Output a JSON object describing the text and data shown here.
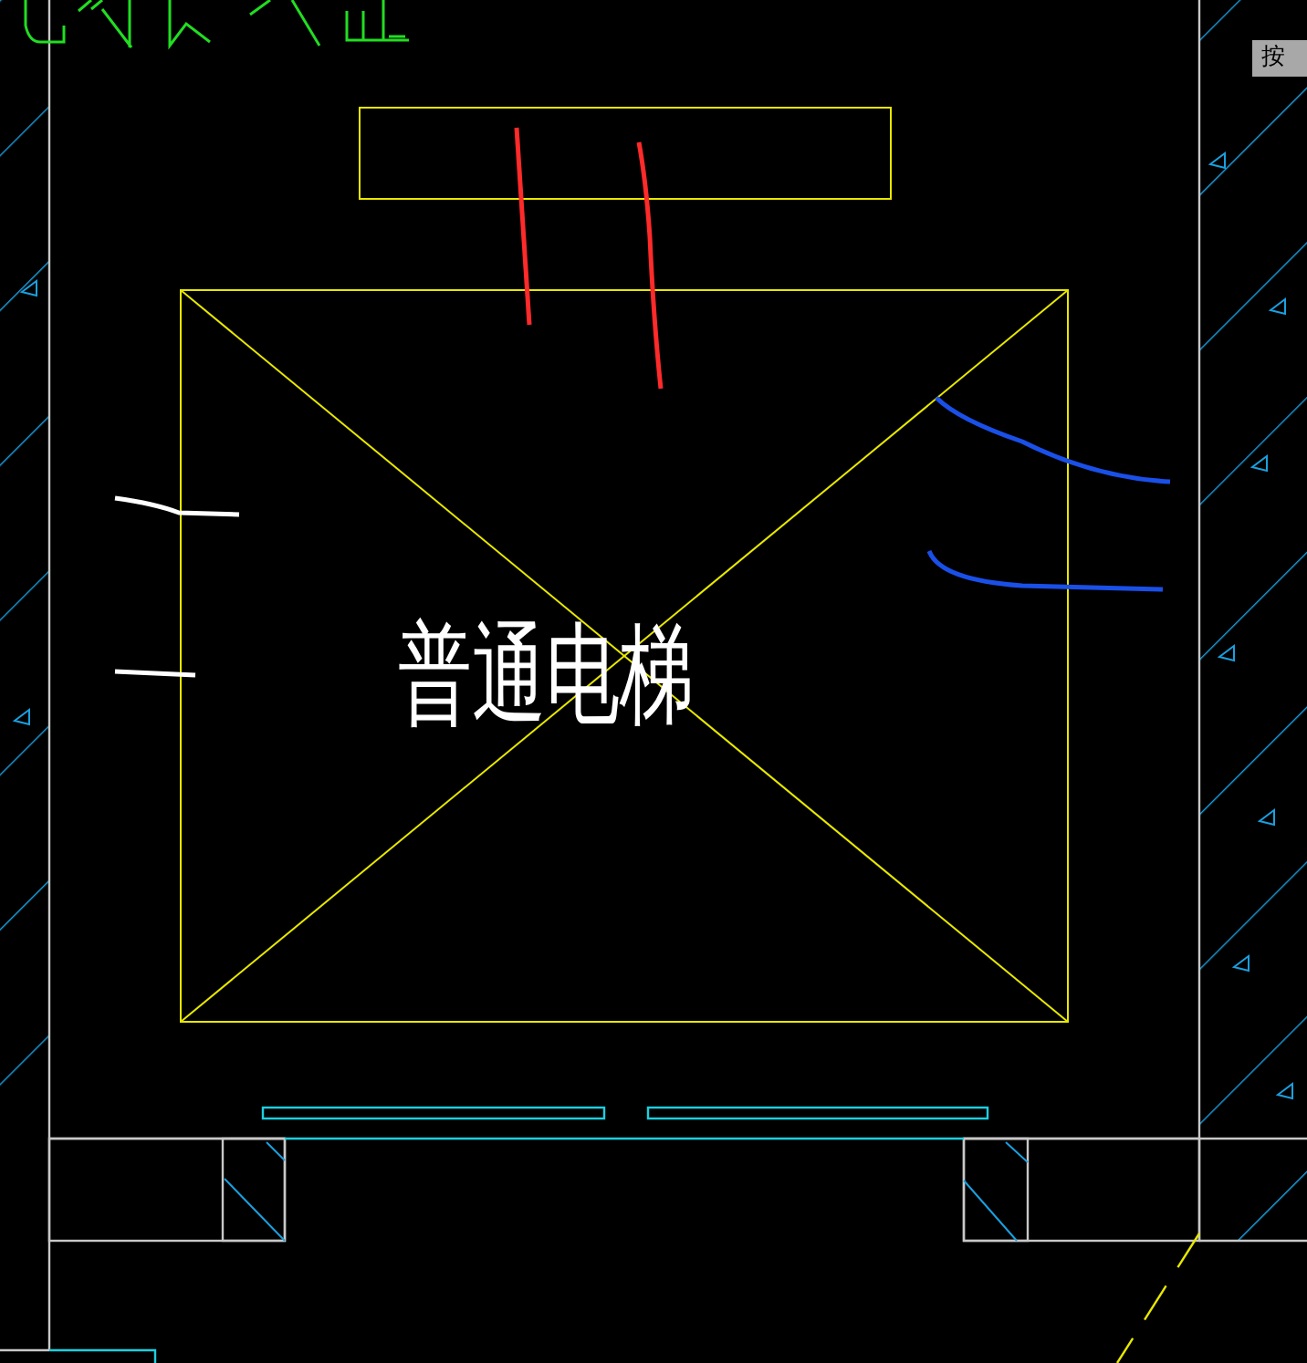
{
  "drawing_label": "普通电梯",
  "tooltip": "按"
}
